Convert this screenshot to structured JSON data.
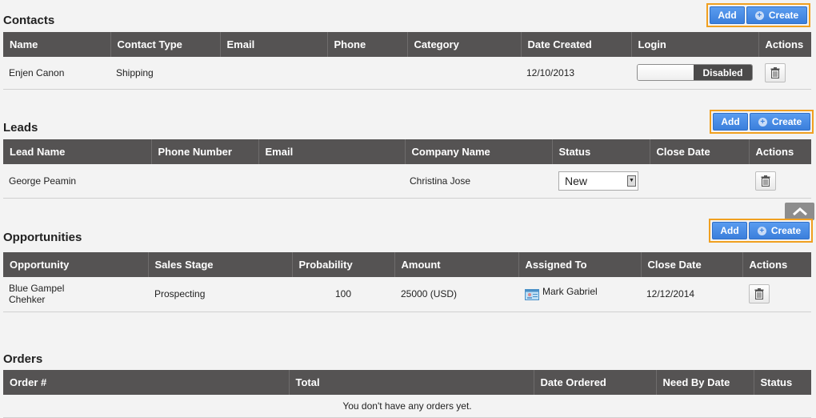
{
  "contacts": {
    "title": "Contacts",
    "add_label": "Add",
    "create_label": "Create",
    "columns": [
      "Name",
      "Contact Type",
      "Email",
      "Phone",
      "Category",
      "Date Created",
      "Login",
      "Actions"
    ],
    "rows": [
      {
        "name": "Enjen Canon",
        "contact_type": "Shipping",
        "email": "",
        "phone": "",
        "category": "",
        "date_created": "12/10/2013",
        "login": "Disabled"
      }
    ]
  },
  "leads": {
    "title": "Leads",
    "add_label": "Add",
    "create_label": "Create",
    "columns": [
      "Lead Name",
      "Phone Number",
      "Email",
      "Company Name",
      "Status",
      "Close Date",
      "Actions"
    ],
    "rows": [
      {
        "lead_name": "George Peamin",
        "phone": "",
        "email": "",
        "company": "Christina Jose",
        "status": "New",
        "close_date": ""
      }
    ]
  },
  "opportunities": {
    "title": "Opportunities",
    "add_label": "Add",
    "create_label": "Create",
    "columns": [
      "Opportunity",
      "Sales Stage",
      "Probability",
      "Amount",
      "Assigned To",
      "Close Date",
      "Actions"
    ],
    "rows": [
      {
        "opportunity": "Blue Gampel Chehker",
        "sales_stage": "Prospecting",
        "probability": "100",
        "amount": "25000 (USD)",
        "assigned_to": "Mark Gabriel",
        "close_date": "12/12/2014"
      }
    ]
  },
  "orders": {
    "title": "Orders",
    "columns": [
      "Order #",
      "Total",
      "Date Ordered",
      "Need By Date",
      "Status"
    ],
    "empty_message": "You don't have any orders yet."
  },
  "colors": {
    "header_bg": "#555353",
    "button_blue": "#3b7fdc",
    "highlight_orange": "#f0a020"
  },
  "icons": {
    "delete": "trash-icon",
    "create": "plus-circle-icon",
    "scroll_top": "chevron-up-icon",
    "assignee": "contact-card-icon"
  }
}
